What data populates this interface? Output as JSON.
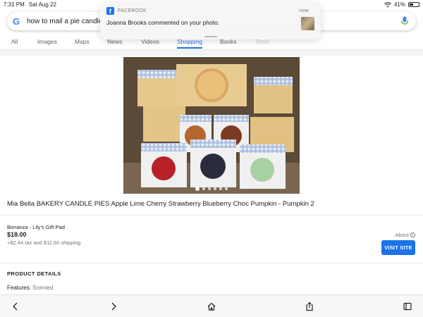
{
  "status_bar": {
    "time": "7:31 PM",
    "date": "Sat Aug 22",
    "battery": "41%"
  },
  "search": {
    "query": "how to mail a pie candle",
    "logo": "G"
  },
  "tabs": [
    {
      "label": "All"
    },
    {
      "label": "Images"
    },
    {
      "label": "Maps"
    },
    {
      "label": "News"
    },
    {
      "label": "Videos"
    },
    {
      "label": "Shopping"
    },
    {
      "label": "Books"
    },
    {
      "label": "Tools"
    }
  ],
  "notification": {
    "app": "FACEBOOK",
    "time": "now",
    "message": "Joanna Brooks commented on your photo.",
    "app_icon_letter": "f"
  },
  "product": {
    "title": "Mia Bella BAKERY CANDLE PIES Apple Lime Cherry Strawberry Blueberry Choc Pumpkin - Pumpkin 2",
    "image_count": 6,
    "active_image": 1
  },
  "offer": {
    "seller": "Bonanza - Lily's Gift Pad",
    "price": "$18.00",
    "shipping": "+$2.44 tax and $11.60 shipping",
    "about_label": "About",
    "about_icon": "i",
    "visit_label": "VISIT SITE"
  },
  "details": {
    "heading": "PRODUCT DETAILS",
    "features_label": "Features:",
    "features_value": "Scented"
  },
  "colors": {
    "accent": "#1a73e8",
    "facebook": "#1877f2"
  },
  "icons": {
    "nav": [
      "back-icon",
      "forward-icon",
      "home-icon",
      "share-icon",
      "tabs-icon"
    ]
  }
}
